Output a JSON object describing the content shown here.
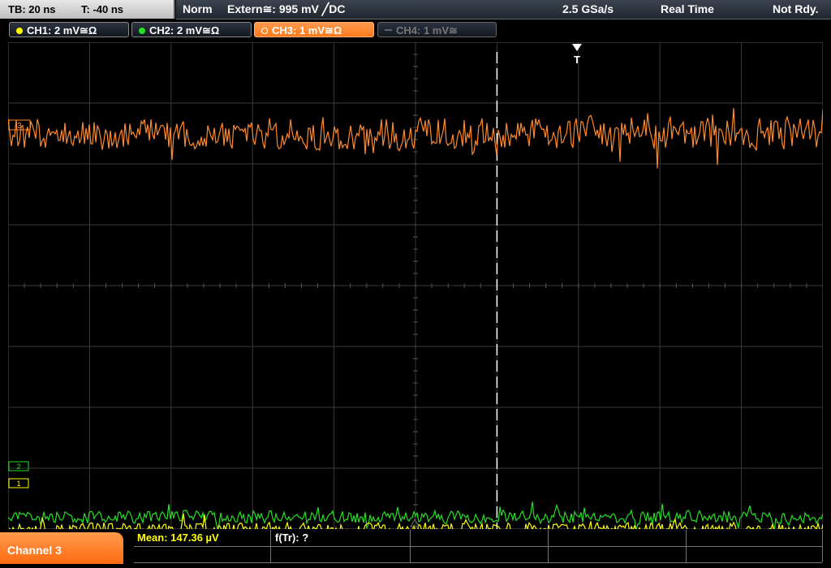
{
  "topbar": {
    "timebase": "TB: 20 ns",
    "trigger_time": "T: -40 ns",
    "acq_mode": "Norm",
    "trigger_source": "Extern≅: 995 mV ╱DC",
    "sample_rate": "2.5 GSa/s",
    "acq_type": "Real Time",
    "status": "Not Rdy."
  },
  "channels": [
    {
      "label": "CH1: 2 mV≅Ω",
      "color": "#ffff00",
      "active": true
    },
    {
      "label": "CH2: 2 mV≅Ω",
      "color": "#22e022",
      "active": true
    },
    {
      "label": "CH3: 1 mV≅Ω",
      "color": "#ff8a2a",
      "active": true,
      "selected": true
    },
    {
      "label": "CH4: 1 mV≅",
      "color": "#777777",
      "active": false
    }
  ],
  "screen": {
    "trigger_marker": "T",
    "ch3_marker": "3",
    "ch2_marker": "2",
    "ch1_marker": "1",
    "colors": {
      "grid": "#3a3a3a",
      "ch1": "#ffff00",
      "ch2": "#22e022",
      "ch3": "#ff8a2a",
      "trigger": "#ffffff"
    },
    "waveforms": {
      "ch3_offset_div": 2.5,
      "ch2_offset_div": -3.8,
      "ch1_offset_div": -4.0,
      "ch3_noise_div": 0.3,
      "ch2_noise_div": 0.12,
      "ch1_noise_div": 0.12,
      "trigger_time_div": 1.0
    }
  },
  "bottom": {
    "selected_channel": "Channel 3",
    "mean": "Mean: 147.36 µV",
    "freq": "f(Tr): ?"
  }
}
